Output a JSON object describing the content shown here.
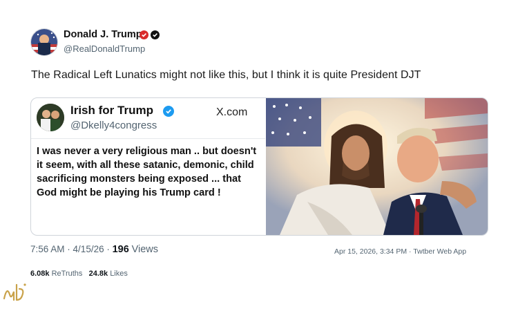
{
  "author": {
    "name": "Donald J. Trump",
    "handle": "@RealDonaldTrump",
    "badges": [
      "red-badge-icon",
      "verified-check-icon"
    ]
  },
  "post": {
    "text": "The Radical Left Lunatics might not like this, but I think it is quite President DJT"
  },
  "quote_card": {
    "name": "Irish for Trump",
    "handle": "@Dkelly4congress",
    "source": "X.com",
    "body": "I was never a very religious man .. but doesn't it seem, with all these satanic, demonic, child sacrificing monsters being exposed ... that God might be playing his Trump card !",
    "badge_icon": "verified-blue-check-icon"
  },
  "meta": {
    "time": "7:56 AM",
    "date": "4/15/26",
    "views_count": "196",
    "views_label": "Views",
    "right_timestamp": "Apr 15, 2026, 3:34 PM · Twtber Web App"
  },
  "stats": {
    "retruths_count": "6.08k",
    "retruths_label": "ReTruths",
    "likes_count": "24.8k",
    "likes_label": "Likes"
  },
  "colors": {
    "verified_blue": "#1d9bf0",
    "badge_red": "#d92b2b",
    "muted_text": "#536471"
  }
}
